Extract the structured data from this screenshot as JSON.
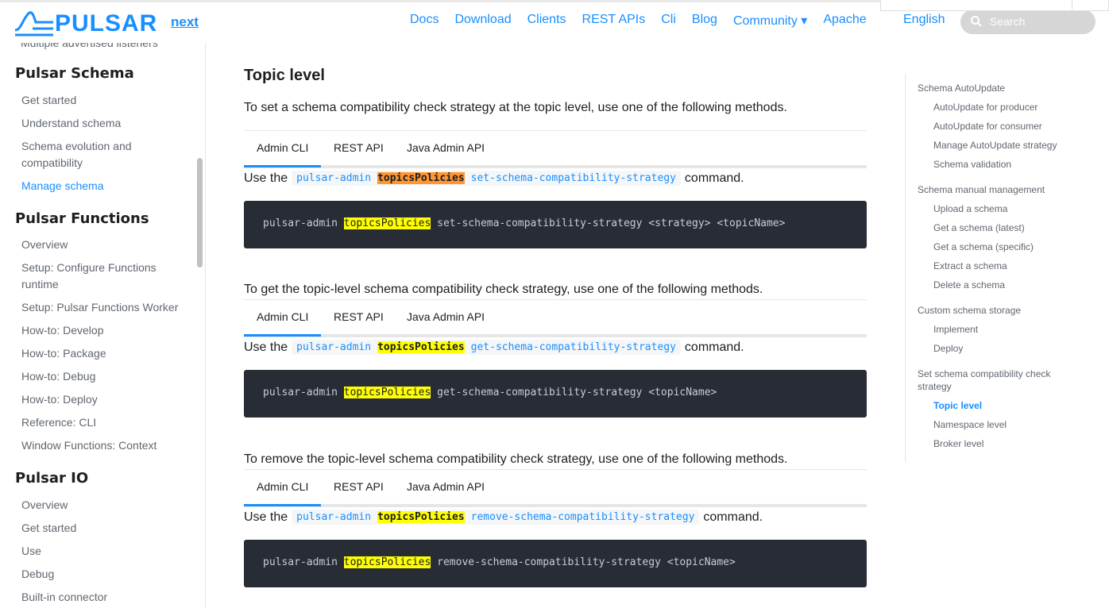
{
  "header": {
    "logo_text": "PULSAR",
    "version_link": "next",
    "nav": [
      "Docs",
      "Download",
      "Clients",
      "REST APIs",
      "Cli",
      "Blog",
      "Community ▾",
      "Apache"
    ],
    "language": "English",
    "search_placeholder": "Search"
  },
  "sidebar": {
    "cut_item": "Multiple advertised listeners",
    "schema_heading": "Pulsar Schema",
    "schema_items": [
      "Get started",
      "Understand schema",
      "Schema evolution and compatibility",
      "Manage schema"
    ],
    "functions_heading": "Pulsar Functions",
    "functions_items": [
      "Overview",
      "Setup: Configure Functions runtime",
      "Setup: Pulsar Functions Worker",
      "How-to: Develop",
      "How-to: Package",
      "How-to: Debug",
      "How-to: Deploy",
      "Reference: CLI",
      "Window Functions: Context"
    ],
    "io_heading": "Pulsar IO",
    "io_items": [
      "Overview",
      "Get started",
      "Use",
      "Debug",
      "Built-in connector"
    ]
  },
  "main": {
    "heading": "Topic level",
    "tabs": [
      "Admin CLI",
      "REST API",
      "Java Admin API"
    ],
    "use_prefix": "Use the",
    "use_suffix": "command.",
    "code_prefix": "pulsar-admin",
    "code_highlight": "topicsPolicies",
    "sections": [
      {
        "intro": "To set a schema compatibility check strategy at the topic level, use one of the following methods.",
        "inline_cmd": "set-schema-compatibility-strategy",
        "code_rest": "set-schema-compatibility-strategy <strategy> <topicName>"
      },
      {
        "intro": "To get the topic-level schema compatibility check strategy, use one of the following methods.",
        "inline_cmd": "get-schema-compatibility-strategy",
        "code_rest": "get-schema-compatibility-strategy <topicName>"
      },
      {
        "intro": "To remove the topic-level schema compatibility check strategy, use one of the following methods.",
        "inline_cmd": "remove-schema-compatibility-strategy",
        "code_rest": "remove-schema-compatibility-strategy <topicName>"
      }
    ]
  },
  "toc": [
    {
      "label": "Schema AutoUpdate",
      "level": 1
    },
    {
      "label": "AutoUpdate for producer",
      "level": 2
    },
    {
      "label": "AutoUpdate for consumer",
      "level": 2
    },
    {
      "label": "Manage AutoUpdate strategy",
      "level": 2
    },
    {
      "label": "Schema validation",
      "level": 2
    },
    {
      "label": "Schema manual management",
      "level": 1
    },
    {
      "label": "Upload a schema",
      "level": 2
    },
    {
      "label": "Get a schema (latest)",
      "level": 2
    },
    {
      "label": "Get a schema (specific)",
      "level": 2
    },
    {
      "label": "Extract a schema",
      "level": 2
    },
    {
      "label": "Delete a schema",
      "level": 2
    },
    {
      "label": "Custom schema storage",
      "level": 1
    },
    {
      "label": "Implement",
      "level": 2
    },
    {
      "label": "Deploy",
      "level": 2
    },
    {
      "label": "Set schema compatibility check strategy",
      "level": 1
    },
    {
      "label": "Topic level",
      "level": 2
    },
    {
      "label": "Namespace level",
      "level": 2
    },
    {
      "label": "Broker level",
      "level": 2
    }
  ],
  "colors": {
    "accent": "#188fff",
    "code_bg": "#282c34",
    "highlight": "#ffff00",
    "highlight_active": "#ff9632"
  }
}
